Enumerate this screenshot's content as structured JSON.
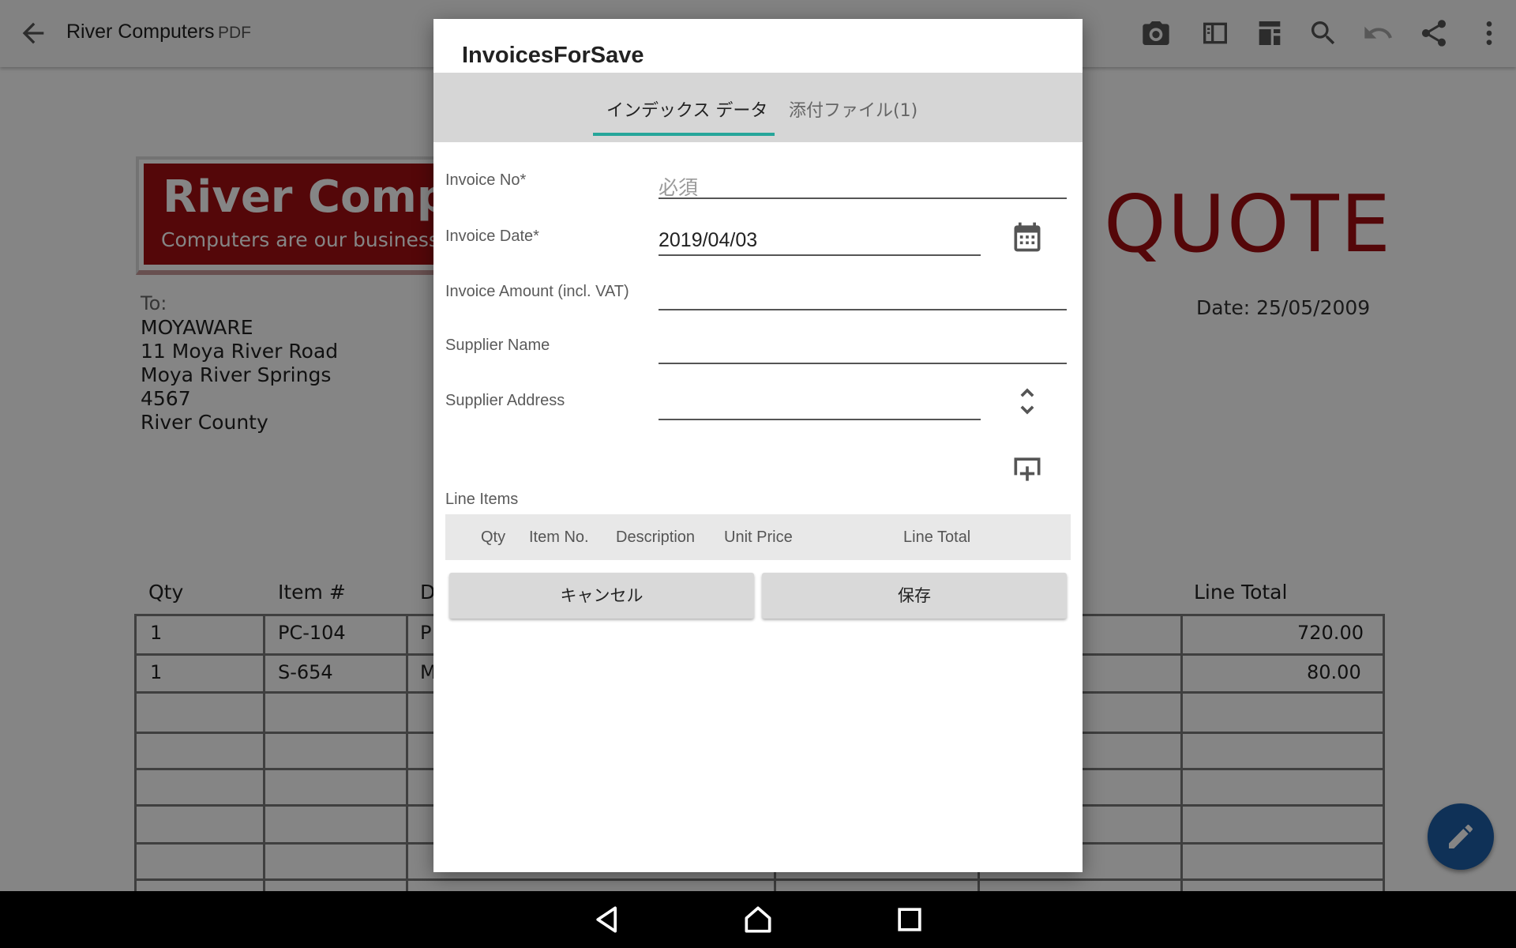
{
  "appbar": {
    "title": "River Computers",
    "subtitle": "PDF",
    "icons": [
      "back-arrow-icon",
      "camera-icon",
      "sidebar-panel-icon",
      "document-layout-icon",
      "search-icon",
      "undo-icon",
      "share-icon",
      "more-vert-icon"
    ]
  },
  "document": {
    "banner_title": "River Compu",
    "banner_subtitle": "Computers are our business.",
    "quote_heading": "QUOTE",
    "date": "Date: 25/05/2009",
    "to_label": "To:",
    "address": [
      "MOYAWARE",
      "11 Moya River Road",
      "Moya River Springs",
      "4567",
      "River County"
    ],
    "table_headers": {
      "qty": "Qty",
      "item": "Item #",
      "desc": "D",
      "line_total": "Line Total"
    },
    "rows": [
      {
        "qty": "1",
        "item": "PC-104",
        "desc": "P",
        "total": "720.00"
      },
      {
        "qty": "1",
        "item": "S-654",
        "desc": "M",
        "total": "80.00"
      }
    ]
  },
  "dialog": {
    "title": "InvoicesForSave",
    "tabs": [
      {
        "label": "インデックス データ",
        "active": true
      },
      {
        "label": "添付ファイル(1)",
        "active": false
      }
    ],
    "fields": {
      "invoice_no": {
        "label": "Invoice No*",
        "value": "",
        "placeholder": "必須"
      },
      "invoice_date": {
        "label": "Invoice Date*",
        "value": "2019/04/03"
      },
      "invoice_amount": {
        "label": "Invoice Amount (incl. VAT)",
        "value": ""
      },
      "supplier_name": {
        "label": "Supplier Name",
        "value": ""
      },
      "supplier_address": {
        "label": "Supplier Address",
        "value": ""
      }
    },
    "line_items": {
      "label": "Line Items",
      "columns": [
        "Qty",
        "Item No.",
        "Description",
        "Unit Price",
        "Line Total"
      ]
    },
    "cancel_label": "キャンセル",
    "save_label": "保存"
  },
  "colors": {
    "brand_red": "#a20f12",
    "tab_indicator": "#26a69a",
    "fab": "#1e5fa8"
  }
}
